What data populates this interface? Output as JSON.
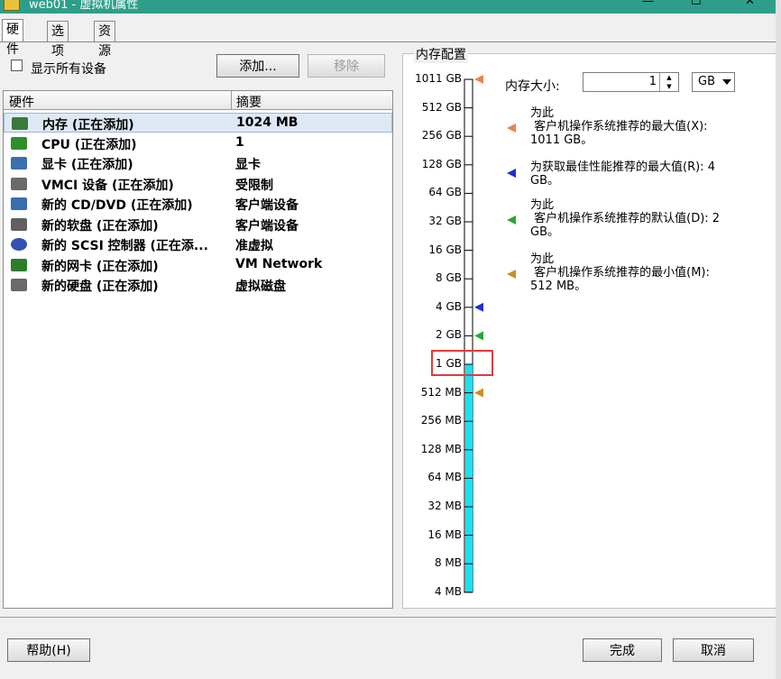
{
  "window": {
    "title": "web01 - 虚拟机属性",
    "min": "—",
    "max": "☐",
    "close": "✕"
  },
  "tabs": [
    "硬件",
    "选项",
    "资源"
  ],
  "show_all_devices": "显示所有设备",
  "buttons": {
    "add": "添加...",
    "remove": "移除",
    "help": "帮助(H)",
    "finish": "完成",
    "cancel": "取消"
  },
  "table": {
    "headers": [
      "硬件",
      "摘要"
    ],
    "rows": [
      {
        "name": "内存 (正在添加)",
        "summary": "1024 MB",
        "icon": "memory-icon"
      },
      {
        "name": "CPU (正在添加)",
        "summary": "1",
        "icon": "cpu-icon"
      },
      {
        "name": "显卡 (正在添加)",
        "summary": "显卡",
        "icon": "display-icon"
      },
      {
        "name": "VMCI 设备 (正在添加)",
        "summary": "受限制",
        "icon": "vmci-icon"
      },
      {
        "name": "新的 CD/DVD (正在添加)",
        "summary": "客户端设备",
        "icon": "cdrom-icon"
      },
      {
        "name": "新的软盘 (正在添加)",
        "summary": "客户端设备",
        "icon": "floppy-icon"
      },
      {
        "name": "新的 SCSI 控制器 (正在添...",
        "summary": "准虚拟",
        "icon": "scsi-icon"
      },
      {
        "name": "新的网卡 (正在添加)",
        "summary": "VM Network",
        "icon": "nic-icon"
      },
      {
        "name": "新的硬盘 (正在添加)",
        "summary": "虚拟磁盘",
        "icon": "disk-icon"
      }
    ]
  },
  "memory_config": {
    "legend": "内存配置",
    "size_label": "内存大小:",
    "size_value": "1",
    "unit": "GB",
    "scale_labels": [
      "1011 GB",
      "512 GB",
      "256 GB",
      "128 GB",
      "64 GB",
      "32 GB",
      "16 GB",
      "8 GB",
      "4 GB",
      "2 GB",
      "1 GB",
      "512 MB",
      "256 MB",
      "128 MB",
      "64 MB",
      "32 MB",
      "16 MB",
      "8 MB",
      "4 MB"
    ],
    "fill_level": "1 GB",
    "recommendations": [
      {
        "line1": "为此",
        "line2": " 客户机操作系统推荐的最大值(X):",
        "line3": "1011 GB。",
        "color": "#f08050"
      },
      {
        "line1": "为获取最佳性能推荐的最大值(R): 4",
        "line2": "GB。",
        "line3": "",
        "color": "#1f2fd0"
      },
      {
        "line1": "为此",
        "line2": " 客户机操作系统推荐的默认值(D): 2",
        "line3": "GB。",
        "color": "#2aa832"
      },
      {
        "line1": "为此",
        "line2": " 客户机操作系统推荐的最小值(M):",
        "line3": "512 MB。",
        "color": "#c89020"
      }
    ]
  }
}
